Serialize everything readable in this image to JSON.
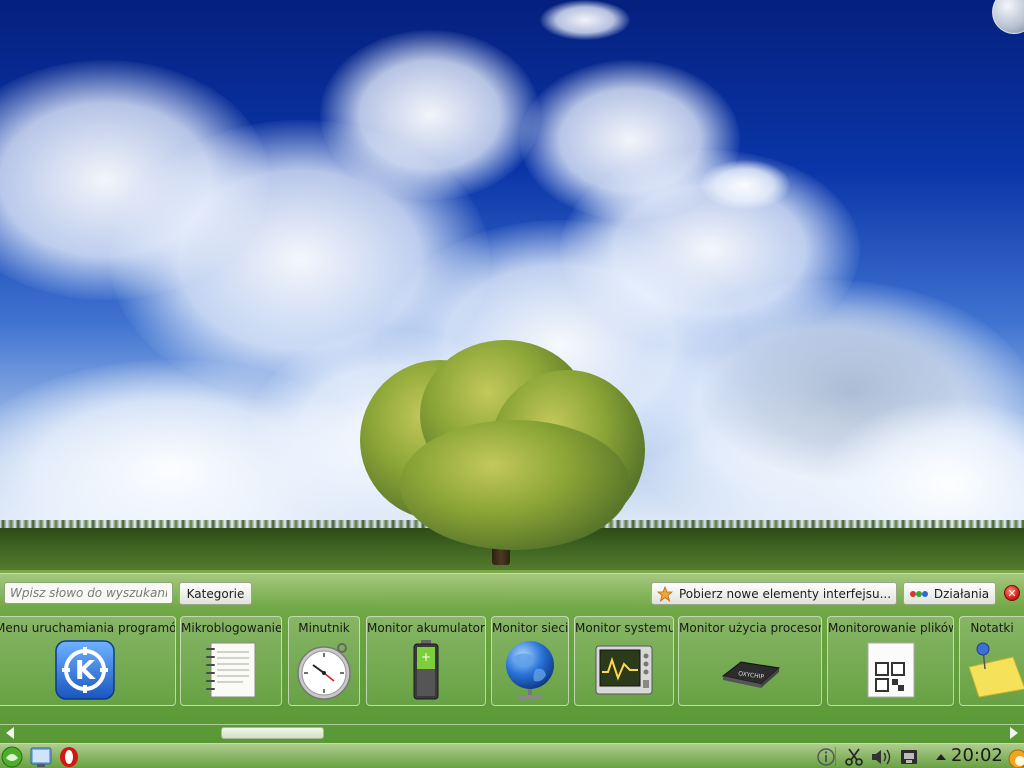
{
  "panel": {
    "search_placeholder": "Wpisz słowo do wyszukania",
    "categories_label": "Kategorie",
    "get_new_widgets_label": "Pobierz nowe elementy interfejsu...",
    "actions_label": "Działania",
    "close_label": "✕"
  },
  "widgets": [
    {
      "label": "Menu uruchamiania programów",
      "icon": "kde-launcher-icon"
    },
    {
      "label": "Mikroblogowanie",
      "icon": "notepad-icon"
    },
    {
      "label": "Minutnik",
      "icon": "stopwatch-icon"
    },
    {
      "label": "Monitor akumulatora",
      "icon": "battery-icon"
    },
    {
      "label": "Monitor sieci",
      "icon": "globe-icon"
    },
    {
      "label": "Monitor systemu",
      "icon": "system-monitor-icon"
    },
    {
      "label": "Monitor użycia procesora",
      "icon": "cpu-chip-icon"
    },
    {
      "label": "Monitorowanie plików",
      "icon": "file-watch-icon"
    },
    {
      "label": "Notatki",
      "icon": "sticky-note-icon"
    }
  ],
  "cpu_chip_text": "OXYCHIP",
  "taskbar": {
    "clock": "20:02"
  },
  "colors": {
    "panel_green": "#5f9934",
    "close_red": "#d4231a",
    "kde_blue": "#2a74d8"
  }
}
